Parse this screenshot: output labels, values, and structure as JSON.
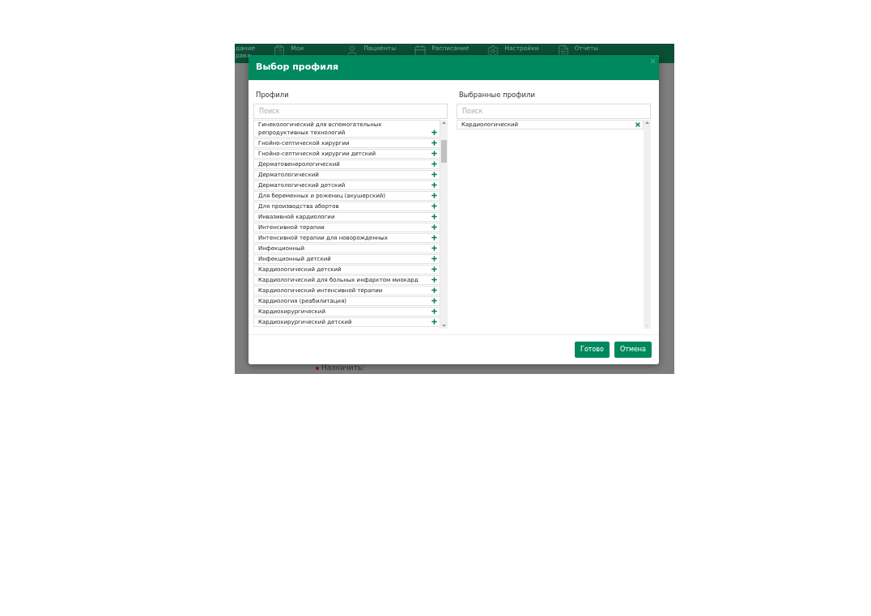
{
  "nav": {
    "items": [
      {
        "kind": "text",
        "lines": [
          "дание",
          "равл"
        ]
      },
      {
        "kind": "clipboard",
        "lines": [
          "Мои"
        ]
      },
      {
        "kind": "user",
        "lines": [
          "Пациенты"
        ]
      },
      {
        "kind": "calendar",
        "lines": [
          "Расписание"
        ]
      },
      {
        "kind": "gear",
        "lines": [
          "Настройки"
        ]
      },
      {
        "kind": "document",
        "lines": [
          "Отчеты"
        ]
      }
    ]
  },
  "background_form": {
    "label": "Назначить:",
    "required": true
  },
  "dialog": {
    "title": "Выбор профиля",
    "profiles": {
      "heading": "Профили",
      "search": {
        "placeholder": "Поиск"
      },
      "items": [
        "Гинекологический для вспомогательных репродуктивных технологий",
        "Гнойно-септической хирургии",
        "Гнойно-септической хирургии детский",
        "Дерматовенерологический",
        "Дерматологический",
        "Дерматологический детский",
        "Для беременных и рожениц (акушерский)",
        "Для производства абортов",
        "Инвазивной кардиологии",
        "Интенсивной терапии",
        "Интенсивной терапии для новорожденных",
        "Инфекционный",
        "Инфекционный детский",
        "Кардиологический детский",
        "Кардиологический для больных инфарктом миокард",
        "Кардиологический интенсивной терапии",
        "Кардиология (реабилитация)",
        "Кардиохирургический",
        "Кардиохирургический детский"
      ]
    },
    "selected_profiles": {
      "heading": "Выбранные профили",
      "search": {
        "placeholder": "Поиск"
      },
      "items": [
        "Кардиологический"
      ]
    },
    "buttons": [
      "Готово",
      "Отмена"
    ]
  }
}
